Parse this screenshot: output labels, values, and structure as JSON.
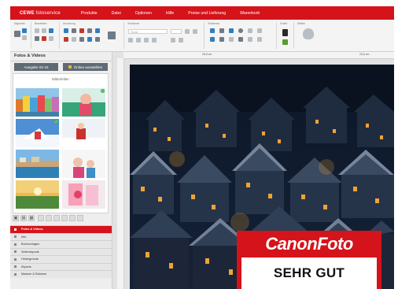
{
  "app": {
    "logo_brand": "CEWE",
    "logo_service": "fotoservice"
  },
  "menu": [
    "Produkte",
    "Datei",
    "Optionen",
    "Hilfe",
    "Preise und Lieferung",
    "Warenkorb"
  ],
  "toolbar": {
    "group_labels": [
      "Allgemein",
      "Bearbeiten",
      "Anordnung",
      "Anordnung",
      "Textformat",
      "Textformat",
      "Schrift",
      "Effekte"
    ],
    "font_placeholder": "Textart"
  },
  "left_panel": {
    "title": "Fotos & Videos",
    "issue_tab": "Ausgabe 02-16",
    "select_online_button": "Online auswählen",
    "gallery_label": "Bilderfelder",
    "nav": [
      "Fotos & Videos",
      "Info",
      "Buchvorlagen",
      "Seitenlayouts",
      "Hintergründe",
      "Kliparts",
      "Masken & Rahmen"
    ],
    "active_nav": "Fotos & Videos"
  },
  "rulers": {
    "label_left": "26,5 cm",
    "label_right": "23,5 cm"
  },
  "badge": {
    "brand_part1": "Canon",
    "brand_part2": "Foto",
    "rating": "SEHR GUT"
  },
  "colors": {
    "accent": "#d4131a",
    "panel_dark": "#5f6a73"
  }
}
